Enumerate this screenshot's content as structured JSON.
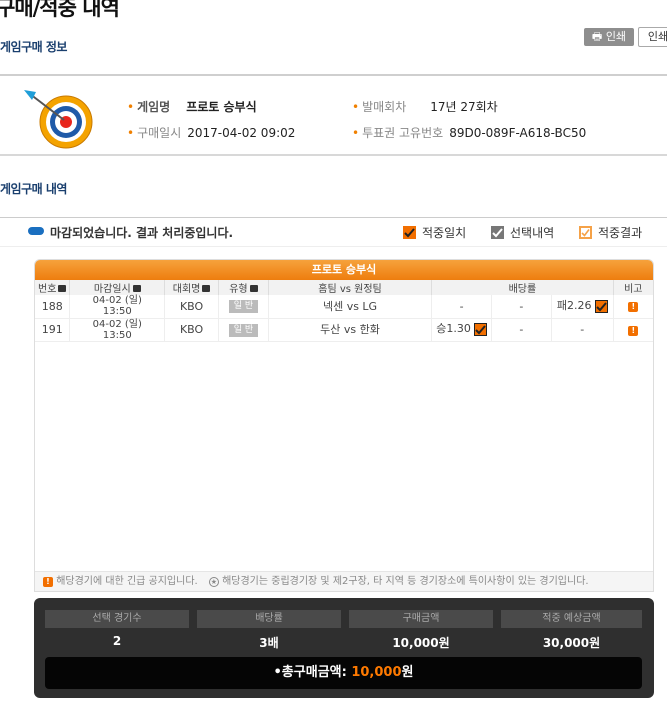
{
  "page_title": "구매/적중 내역",
  "print_button": "인쇄",
  "print_button2": "인쇄",
  "game_info": {
    "section_title": "게임구매 정보",
    "game_name_label": "게임명",
    "game_name": "프로토 승부식",
    "round_label": "발매회차",
    "round": "17년 27회차",
    "purchase_date_label": "구매일시",
    "purchase_date": "2017-04-02 09:02",
    "ticket_id_label": "투표권 고유번호",
    "ticket_id": "89D0-089F-A618-BC50"
  },
  "purchase_detail": {
    "section_title": "게임구매 내역",
    "status_text": "마감되었습니다. 결과 처리중입니다.",
    "legend": [
      "적중일치",
      "선택내역",
      "적중결과"
    ]
  },
  "table": {
    "panel_title": "프로토 승부식",
    "headers": [
      "번호",
      "마감일시",
      "대회명",
      "유형",
      "홈팀 vs 원정팀",
      "배당률",
      "비고"
    ],
    "rows": [
      {
        "no": "188",
        "date": "04-02 (일)",
        "time": "13:50",
        "league": "KBO",
        "type": "일 반",
        "match": "넥센 vs LG",
        "odd1": "-",
        "odd2": "-",
        "odd3": "패2.26"
      },
      {
        "no": "191",
        "date": "04-02 (일)",
        "time": "13:50",
        "league": "KBO",
        "type": "일 반",
        "match": "두산 vs 한화",
        "odd1": "승1.30",
        "odd2": "-",
        "odd3": "-"
      }
    ],
    "footnote1": "해당경기에 대한 긴급 공지입니다.",
    "footnote2": "해당경기는 중립경기장 및 제2구장, 타 지역 등 경기장소에 특이사항이 있는 경기입니다."
  },
  "summary": {
    "headers": [
      "선택 경기수",
      "배당률",
      "구매금액",
      "적중 예상금액"
    ],
    "values": [
      "2",
      "3배",
      "10,000원",
      "30,000원"
    ],
    "total_label": "•총구매금액: ",
    "total_value": "10,000",
    "total_unit": "원"
  },
  "colors": {
    "accent": "#f26f00",
    "navy": "#1a3f6e",
    "blue": "#1a6fc0"
  }
}
